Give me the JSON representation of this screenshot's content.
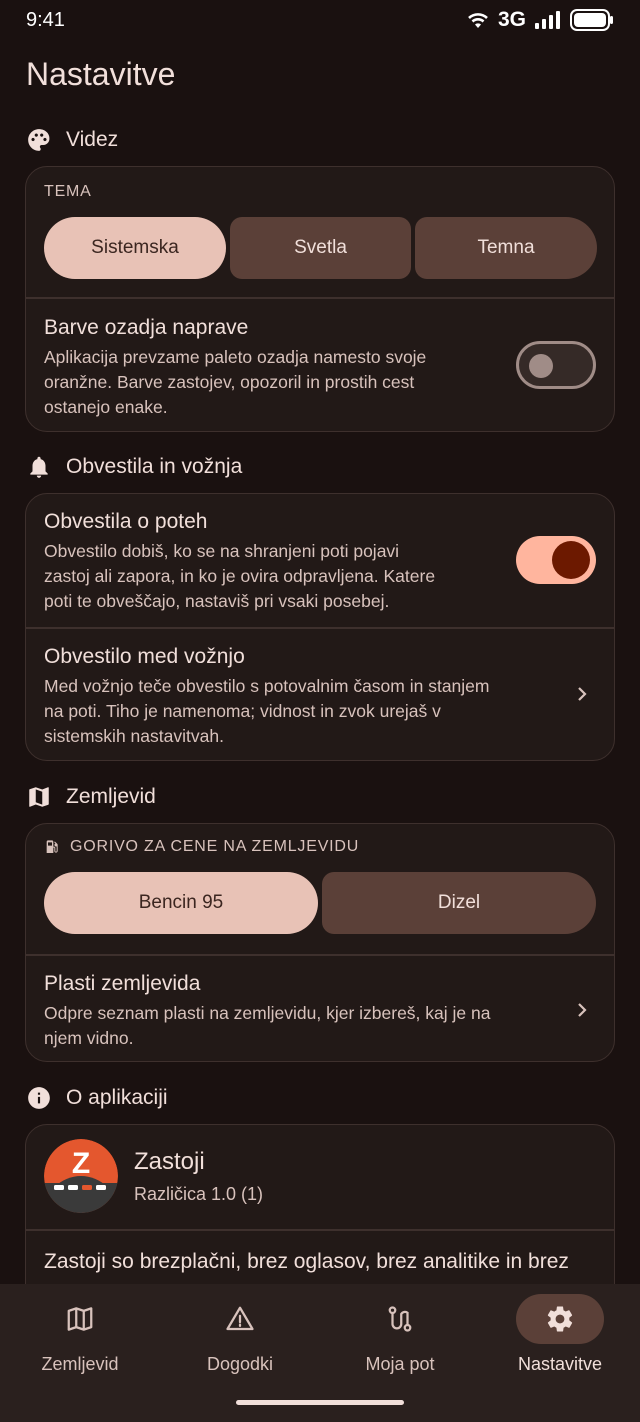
{
  "status_bar": {
    "time": "9:41",
    "network": "3G"
  },
  "page": {
    "title": "Nastavitve"
  },
  "sections": {
    "video": {
      "header": "Videz",
      "theme_label": "TEMA",
      "theme_options": [
        "Sistemska",
        "Svetla",
        "Temna"
      ],
      "theme_selected": "Sistemska",
      "device_colors": {
        "title": "Barve ozadja naprave",
        "desc_lines": [
          "Aplikacija prevzame paleto ozadja namesto svoje",
          "oranžne. Barve zastojev, opozoril in prostih cest",
          "ostanejo enake."
        ],
        "enabled": false
      }
    },
    "notifications": {
      "header": "Obvestila in vožnja",
      "route_alerts": {
        "title": "Obvestila o poteh",
        "desc_lines": [
          "Obvestilo dobiš, ko se na shranjeni poti pojavi",
          "zastoj ali zapora, in ko je ovira odpravljena. Katere",
          "poti te obveščajo, nastaviš pri vsaki posebej."
        ],
        "enabled": true
      },
      "drive_notification": {
        "title": "Obvestilo med vožnjo",
        "desc_lines": [
          "Med vožnjo teče obvestilo s potovalnim časom in stanjem",
          "na poti. Tiho je namenoma; vidnost in zvok urejaš v",
          "sistemskih nastavitvah."
        ]
      }
    },
    "map": {
      "header": "Zemljevid",
      "fuel_label": "GORIVO ZA CENE NA ZEMLJEVIDU",
      "fuel_options": [
        "Bencin 95",
        "Dizel"
      ],
      "fuel_selected": "Bencin 95",
      "layers": {
        "title": "Plasti zemljevida",
        "desc_lines": [
          "Odpre seznam plasti na zemljevidu, kjer izbereš, kaj je na",
          "njem vidno."
        ]
      }
    },
    "about": {
      "header": "O aplikaciji",
      "app_name": "Zastoji",
      "version": "Različica 1.0 (1)",
      "logo_letter": "Z",
      "text": "Zastoji so brezplačni, brez oglasov, brez analitike in brez"
    }
  },
  "bottom_nav": {
    "items": [
      {
        "label": "Zemljevid",
        "icon": "map-icon"
      },
      {
        "label": "Dogodki",
        "icon": "warning-icon"
      },
      {
        "label": "Moja pot",
        "icon": "route-icon"
      },
      {
        "label": "Nastavitve",
        "icon": "gear-icon"
      }
    ],
    "active": "Nastavitve"
  },
  "colors": {
    "background": "#1a1110",
    "card": "#221917",
    "accent": "#ffb59e",
    "selected_segment": "#e8c2b6",
    "logo_orange": "#e4572e"
  }
}
